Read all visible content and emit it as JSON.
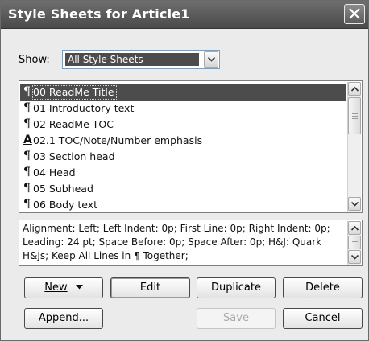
{
  "window": {
    "title": "Style Sheets for Article1"
  },
  "show": {
    "label": "Show:",
    "selected": "All Style Sheets"
  },
  "styles": [
    {
      "icon": "paragraph",
      "glyph": "¶",
      "name": "00 ReadMe Title",
      "selected": true
    },
    {
      "icon": "paragraph",
      "glyph": "¶",
      "name": "01 Introductory text"
    },
    {
      "icon": "paragraph",
      "glyph": "¶",
      "name": "02 ReadMe TOC"
    },
    {
      "icon": "character",
      "glyph": "A",
      "name": "02.1 TOC/Note/Number emphasis"
    },
    {
      "icon": "paragraph",
      "glyph": "¶",
      "name": "03 Section head"
    },
    {
      "icon": "paragraph",
      "glyph": "¶",
      "name": "04 Head"
    },
    {
      "icon": "paragraph",
      "glyph": "¶",
      "name": "05 Subhead"
    },
    {
      "icon": "paragraph",
      "glyph": "¶",
      "name": "06 Body text"
    }
  ],
  "description": "Alignment: Left;  Left Indent: 0p;  First Line: 0p;  Right Indent: 0p;  Leading: 24 pt;  Space Before: 0p;  Space After: 0p;  H&J: Quark H&Js;  Keep All Lines in ¶ Together;",
  "buttons": {
    "new": {
      "label": "New"
    },
    "edit": "Edit",
    "duplicate": "Duplicate",
    "delete": "Delete",
    "append": "Append...",
    "save": "Save",
    "cancel": "Cancel"
  }
}
